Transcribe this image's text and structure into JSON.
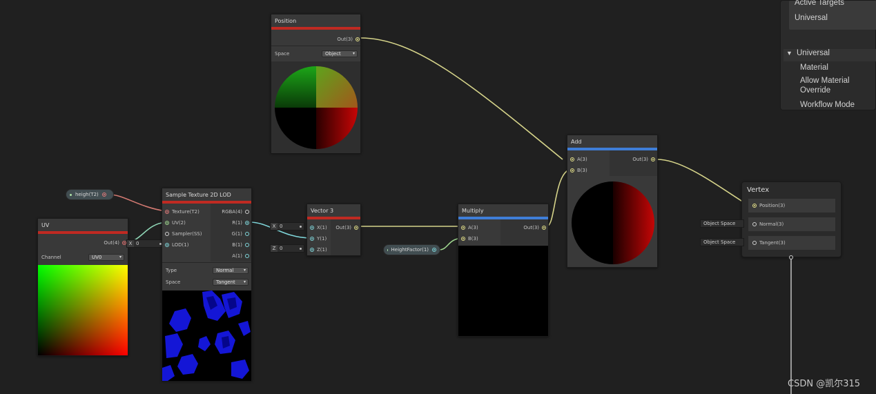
{
  "graph_inspector": {
    "active_targets_label": "Active Targets",
    "target_value": "Universal",
    "section_title": "Universal",
    "items": [
      "Material",
      "Allow Material",
      "Override",
      "Workflow Mode"
    ]
  },
  "nodes": {
    "position": {
      "title": "Position",
      "out_label": "Out(3)",
      "space_label": "Space",
      "space_value": "Object"
    },
    "uv": {
      "title": "UV",
      "out_label": "Out(4)",
      "channel_label": "Channel",
      "channel_value": "UV0"
    },
    "height_prop": {
      "label": "heigh(T2)"
    },
    "sample_texture": {
      "title": "Sample Texture 2D LOD",
      "inputs": [
        "Texture(T2)",
        "UV(2)",
        "Sampler(SS)",
        "LOD(1)"
      ],
      "outputs": [
        "RGBA(4)",
        "R(1)",
        "G(1)",
        "B(1)",
        "A(1)"
      ],
      "type_label": "Type",
      "type_value": "Normal",
      "space_label": "Space",
      "space_value": "Tangent",
      "lod_field_axis": "X",
      "lod_field_value": "0"
    },
    "vector3": {
      "title": "Vector 3",
      "inputs": [
        "X(1)",
        "Y(1)",
        "Z(1)"
      ],
      "out_label": "Out(3)",
      "x_axis": "X",
      "x_value": "0",
      "z_axis": "Z",
      "z_value": "0"
    },
    "height_factor": {
      "label": "HeightFactor(1)"
    },
    "multiply": {
      "title": "Multiply",
      "inputs": [
        "A(3)",
        "B(3)"
      ],
      "out_label": "Out(3)"
    },
    "add": {
      "title": "Add",
      "inputs": [
        "A(3)",
        "B(3)"
      ],
      "out_label": "Out(3)"
    },
    "vertex": {
      "title": "Vertex",
      "ports": [
        "Position(3)",
        "Normal(3)",
        "Tangent(3)"
      ],
      "normal_space": "Object Space",
      "tangent_space": "Object Space"
    }
  },
  "watermark": "CSDN @凯尔315",
  "colors": {
    "background": "#202020",
    "node_body": "#393939",
    "header_bar_red": "#c02a22",
    "header_bar_blue": "#3f7ed8",
    "wire_vector3": "#e6e28a",
    "wire_vector2": "#9fd78f",
    "wire_float": "#7fd6da",
    "wire_texture": "#e17a7a"
  }
}
